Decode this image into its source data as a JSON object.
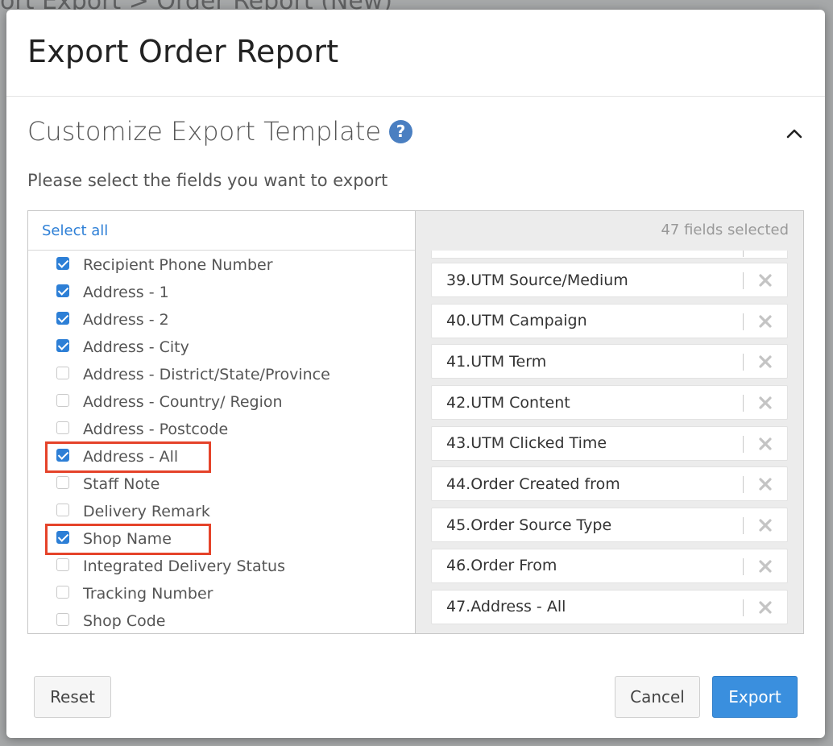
{
  "background": {
    "breadcrumb": "ort Export  >  Order Report (New)"
  },
  "modal": {
    "title": "Export Order Report",
    "section_title": "Customize Export Template",
    "subtitle": "Please select the fields you want to export"
  },
  "left_panel": {
    "select_all_label": "Select all",
    "fields": [
      {
        "label": "Recipient Phone Number",
        "checked": true
      },
      {
        "label": "Address - 1",
        "checked": true
      },
      {
        "label": "Address - 2",
        "checked": true
      },
      {
        "label": "Address - City",
        "checked": true
      },
      {
        "label": "Address - District/State/Province",
        "checked": false
      },
      {
        "label": "Address - Country/ Region",
        "checked": false
      },
      {
        "label": "Address - Postcode",
        "checked": false
      },
      {
        "label": "Address - All",
        "checked": true,
        "highlighted": true
      },
      {
        "label": "Staff Note",
        "checked": false
      },
      {
        "label": "Delivery Remark",
        "checked": false
      },
      {
        "label": "Shop Name",
        "checked": true,
        "highlighted": true
      },
      {
        "label": "Integrated Delivery Status",
        "checked": false
      },
      {
        "label": "Tracking Number",
        "checked": false
      },
      {
        "label": "Shop Code",
        "checked": false
      }
    ]
  },
  "right_panel": {
    "selected_count_label": "47 fields selected",
    "selected": [
      "39.UTM Source/Medium",
      "40.UTM Campaign",
      "41.UTM Term",
      "42.UTM Content",
      "43.UTM Clicked Time",
      "44.Order Created from",
      "45.Order Source Type",
      "46.Order From",
      "47.Address - All"
    ]
  },
  "footer": {
    "reset_label": "Reset",
    "cancel_label": "Cancel",
    "export_label": "Export"
  },
  "colors": {
    "accent": "#2d7fd6",
    "export_button": "#3a8fde",
    "highlight_border": "#e5432a",
    "help_icon": "#4a7fc1"
  },
  "icons": {
    "help": "question-circle-icon",
    "collapse": "chevron-up-icon",
    "remove": "close-icon"
  }
}
